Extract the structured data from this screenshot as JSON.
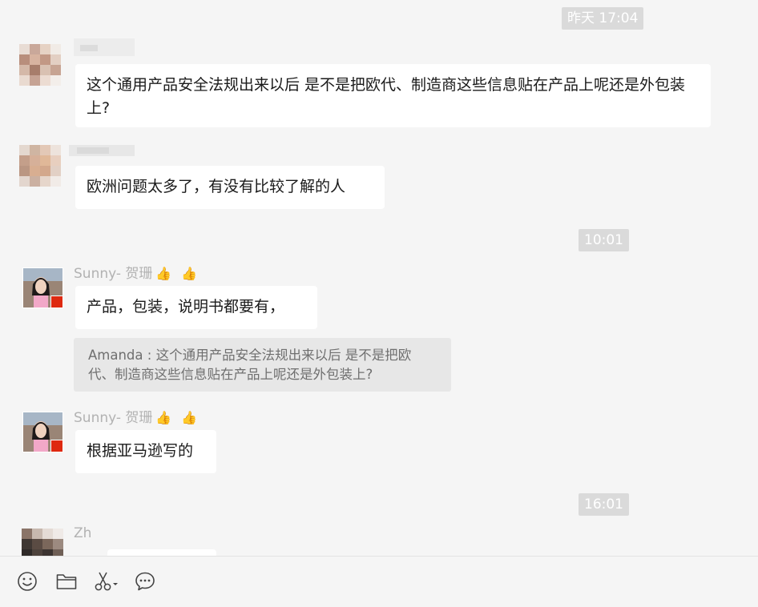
{
  "timestamps": [
    "昨天 17:04",
    "10:01",
    "16:01"
  ],
  "messages": [
    {
      "sender": "",
      "text": "这个通用产品安全法规出来以后 是不是把欧代、制造商这些信息贴在产品上呢还是外包装上?"
    },
    {
      "sender": "",
      "text": "欧洲问题太多了，有没有比较了解的人"
    },
    {
      "sender": "Sunny- 贺珊",
      "text": "产品，包装，说明书都要有，",
      "quote": "Amanda : 这个通用产品安全法规出来以后 是不是把欧代、制造商这些信息贴在产品上呢还是外包装上?"
    },
    {
      "sender": "Sunny- 贺珊",
      "text": "根据亚马逊写的"
    },
    {
      "sender": "Zh",
      "text": ""
    }
  ],
  "toolbar": {
    "icons": [
      "emoji-icon",
      "folder-icon",
      "scissors-icon",
      "chat-history-icon"
    ]
  },
  "colors": {
    "background": "#f5f5f5",
    "bubble": "#ffffff",
    "timestamp_bg": "#dadada",
    "quote_bg": "#e7e7e7"
  }
}
